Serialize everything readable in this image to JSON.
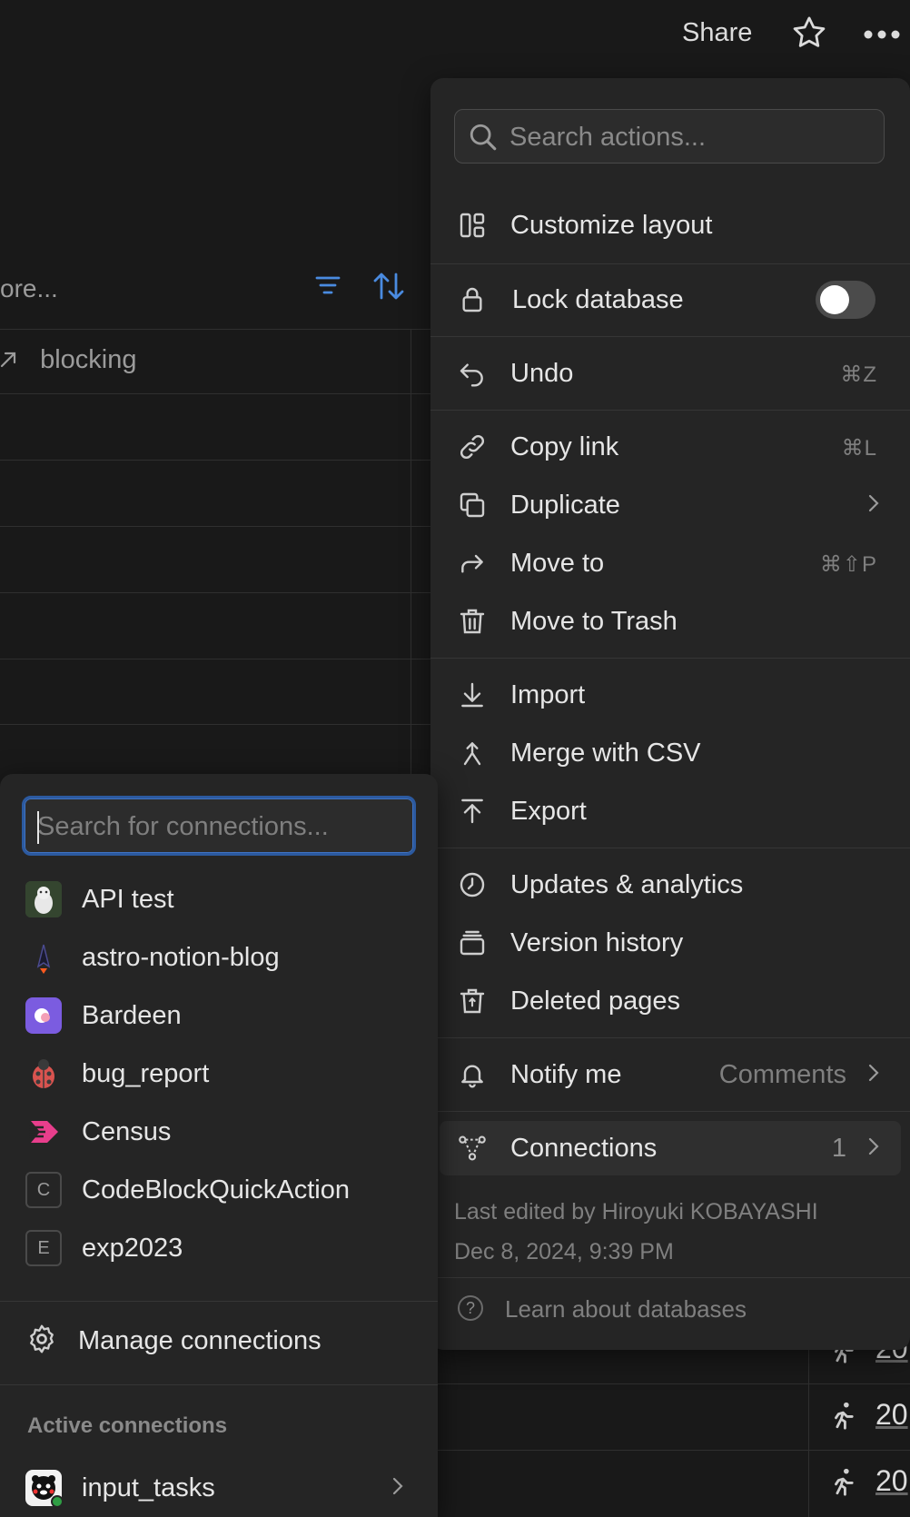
{
  "topbar": {
    "share_label": "Share",
    "star_icon": "star-icon",
    "more_icon": "more-dots-icon"
  },
  "background": {
    "toolbar_text": "ore...",
    "column_header": "blocking",
    "rows": [
      {
        "date": "20"
      },
      {
        "date": "20"
      },
      {
        "date": "20"
      }
    ]
  },
  "menu": {
    "search_placeholder": "Search actions...",
    "items": {
      "customize_layout": "Customize layout",
      "lock_database": "Lock database",
      "undo": "Undo",
      "undo_shortcut": "⌘Z",
      "copy_link": "Copy link",
      "copy_link_shortcut": "⌘L",
      "duplicate": "Duplicate",
      "move_to": "Move to",
      "move_to_shortcut": "⌘⇧P",
      "move_to_trash": "Move to Trash",
      "import": "Import",
      "merge_csv": "Merge with CSV",
      "export": "Export",
      "updates_analytics": "Updates & analytics",
      "version_history": "Version history",
      "deleted_pages": "Deleted pages",
      "notify_me": "Notify me",
      "notify_value": "Comments",
      "connections": "Connections",
      "connections_count": "1"
    },
    "lock_toggle_on": false,
    "last_edited": "Last edited by Hiroyuki KOBAYASHI",
    "last_edited_date": "Dec 8, 2024, 9:39 PM",
    "learn": "Learn about databases"
  },
  "connections_menu": {
    "search_placeholder": "Search for connections...",
    "items": [
      {
        "label": "API test"
      },
      {
        "label": "astro-notion-blog"
      },
      {
        "label": "Bardeen"
      },
      {
        "label": "bug_report"
      },
      {
        "label": "Census"
      },
      {
        "label": "CodeBlockQuickAction",
        "letter": "C"
      },
      {
        "label": "exp2023",
        "letter": "E"
      }
    ],
    "manage": "Manage connections",
    "active_heading": "Active connections",
    "active_items": [
      {
        "label": "input_tasks"
      }
    ]
  }
}
